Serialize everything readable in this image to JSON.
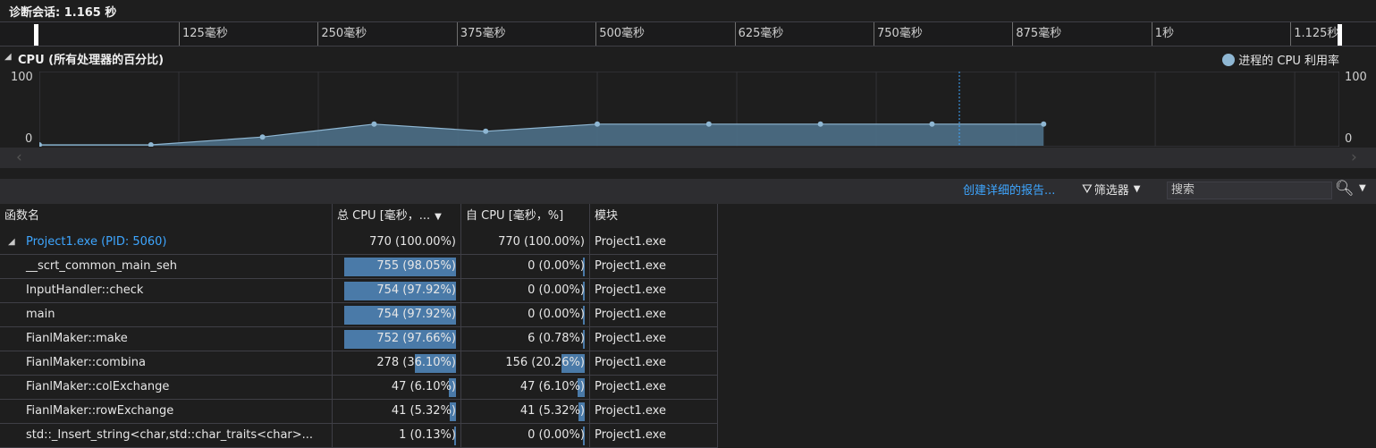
{
  "session": {
    "title": "诊断会话: 1.165 秒"
  },
  "ruler": {
    "ticks": [
      "125毫秒",
      "250毫秒",
      "375毫秒",
      "500毫秒",
      "625毫秒",
      "750毫秒",
      "875毫秒",
      "1秒",
      "1.125秒"
    ]
  },
  "cpu_panel": {
    "title": "CPU (所有处理器的百分比)",
    "legend": "进程的 CPU 利用率",
    "y_max_label": "100",
    "y_min_label": "0",
    "accent_color": "#8fb7d3"
  },
  "chart_data": {
    "type": "area",
    "ylim": [
      0,
      100
    ],
    "xlim": [
      0,
      1.165
    ],
    "x": [
      0.0,
      0.1,
      0.2,
      0.3,
      0.4,
      0.5,
      0.6,
      0.7,
      0.8,
      0.9
    ],
    "series": [
      {
        "values": [
          0,
          0,
          11,
          29,
          19,
          29,
          29,
          29,
          29,
          29
        ]
      }
    ],
    "gridlines": true
  },
  "toolbar": {
    "report_link": "创建详细的报告...",
    "filter_label": "筛选器",
    "search_placeholder": "搜索"
  },
  "table": {
    "columns": [
      "函数名",
      "总 CPU [毫秒，...",
      "自 CPU [毫秒，%]",
      "模块"
    ],
    "rows": [
      {
        "name": "Project1.exe (PID: 5060)",
        "total": "770 (100.00%)",
        "total_pct": 100.0,
        "self": "770 (100.00%)",
        "self_pct": 100.0,
        "module": "Project1.exe",
        "root": true
      },
      {
        "name": "__scrt_common_main_seh",
        "total": "755 (98.05%)",
        "total_pct": 98.05,
        "self": "0 (0.00%)",
        "self_pct": 0.0,
        "module": "Project1.exe"
      },
      {
        "name": "InputHandler::check",
        "total": "754 (97.92%)",
        "total_pct": 97.92,
        "self": "0 (0.00%)",
        "self_pct": 0.0,
        "module": "Project1.exe"
      },
      {
        "name": "main",
        "total": "754 (97.92%)",
        "total_pct": 97.92,
        "self": "0 (0.00%)",
        "self_pct": 0.0,
        "module": "Project1.exe"
      },
      {
        "name": "FianlMaker::make",
        "total": "752 (97.66%)",
        "total_pct": 97.66,
        "self": "6 (0.78%)",
        "self_pct": 0.78,
        "module": "Project1.exe"
      },
      {
        "name": "FianlMaker::combina",
        "total": "278 (36.10%)",
        "total_pct": 36.1,
        "self": "156 (20.26%)",
        "self_pct": 20.26,
        "module": "Project1.exe"
      },
      {
        "name": "FianlMaker::colExchange",
        "total": "47 (6.10%)",
        "total_pct": 6.1,
        "self": "47 (6.10%)",
        "self_pct": 6.1,
        "module": "Project1.exe"
      },
      {
        "name": "FianlMaker::rowExchange",
        "total": "41 (5.32%)",
        "total_pct": 5.32,
        "self": "41 (5.32%)",
        "self_pct": 5.32,
        "module": "Project1.exe"
      },
      {
        "name": "std::_Insert_string<char,std::char_traits<char>...",
        "total": "1 (0.13%)",
        "total_pct": 0.13,
        "self": "0 (0.00%)",
        "self_pct": 0.0,
        "module": "Project1.exe"
      }
    ]
  }
}
